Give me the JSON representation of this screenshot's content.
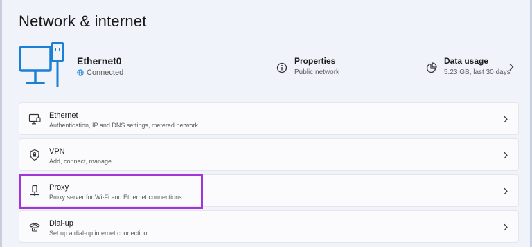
{
  "page": {
    "title": "Network & internet"
  },
  "connection": {
    "name": "Ethernet0",
    "status": "Connected",
    "icon": "monitor-ethernet-icon"
  },
  "properties": {
    "title": "Properties",
    "subtitle": "Public network",
    "icon": "info-icon"
  },
  "data_usage": {
    "title": "Data usage",
    "subtitle": "5.23 GB, last 30 days",
    "icon": "pie-chart-icon"
  },
  "items": [
    {
      "title": "Ethernet",
      "description": "Authentication, IP and DNS settings, metered network",
      "icon": "ethernet-icon"
    },
    {
      "title": "VPN",
      "description": "Add, connect, manage",
      "icon": "shield-icon"
    },
    {
      "title": "Proxy",
      "description": "Proxy server for Wi-Fi and Ethernet connections",
      "icon": "proxy-icon"
    },
    {
      "title": "Dial-up",
      "description": "Set up a dial-up internet connection",
      "icon": "dialup-icon"
    }
  ],
  "colors": {
    "accent": "#1a80d6",
    "highlight": "#a235d8",
    "background": "#f0f3f9",
    "card": "#fbfbfd"
  }
}
